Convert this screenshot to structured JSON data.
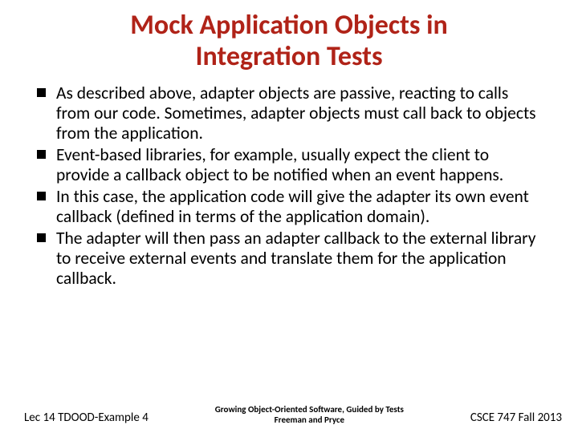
{
  "title_line1": "Mock Application Objects in",
  "title_line2": "Integration Tests",
  "bullets": [
    "As described above, adapter objects are passive, reacting to calls from our code. Sometimes, adapter objects must call back to objects from the application.",
    "Event-based libraries, for example, usually expect the client to provide a callback object to be notified when an event happens.",
    "In this case, the application code will give the adapter its own event callback (defined in terms of the application domain).",
    "The adapter will then pass an adapter callback to the external library to receive external events and translate them for the application callback."
  ],
  "footer": {
    "left": "Lec 14 TDOOD-Example 4",
    "center_line1": "Growing Object-Oriented Software, Guided by Tests",
    "center_line2": "Freeman and Pryce",
    "right": "CSCE 747 Fall 2013"
  }
}
